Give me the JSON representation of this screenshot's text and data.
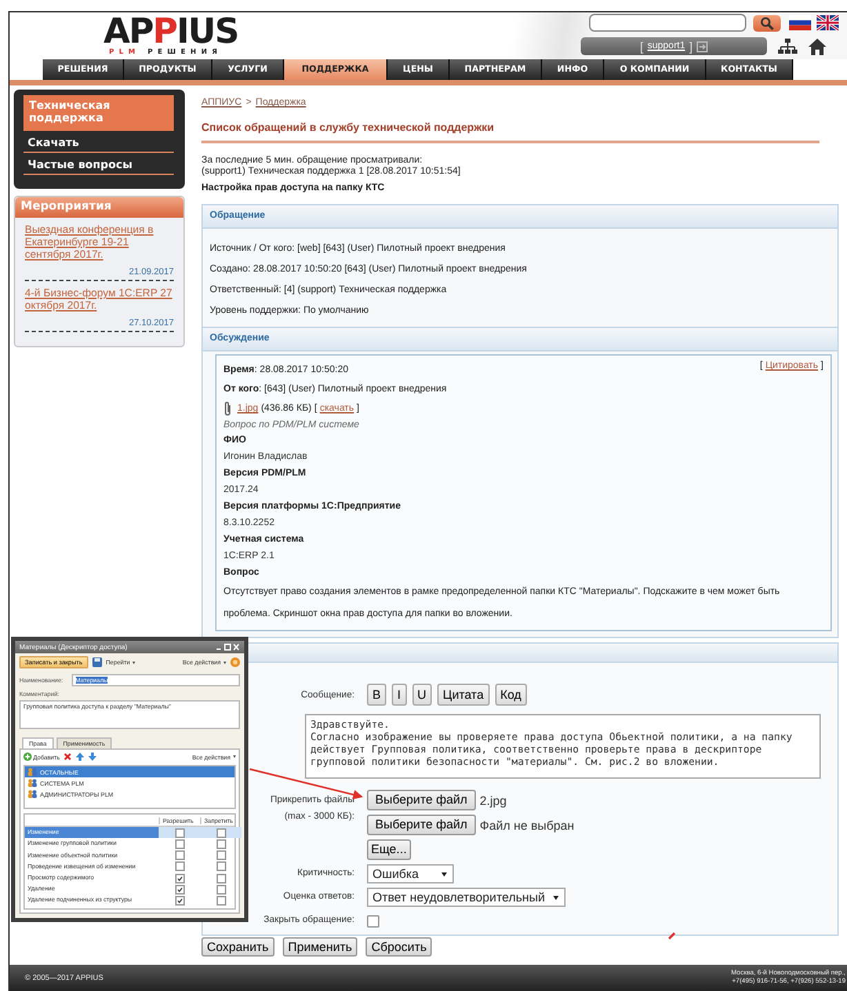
{
  "header": {
    "logo": {
      "parts": [
        {
          "text": "AP",
          "accent": false
        },
        {
          "text": "P",
          "accent": true
        },
        {
          "text": "IUS",
          "accent": false
        }
      ]
    },
    "tagline": {
      "parts": [
        {
          "text": "PLM",
          "accent": true
        },
        {
          "text": " РЕШЕНИЯ",
          "accent": false
        }
      ]
    },
    "user": {
      "open": "[",
      "name": "support1",
      "close": "]"
    }
  },
  "nav": [
    {
      "label": "РЕШЕНИЯ",
      "selected": false
    },
    {
      "label": "ПРОДУКТЫ",
      "selected": false
    },
    {
      "label": "УСЛУГИ",
      "selected": false
    },
    {
      "label": "ПОДДЕРЖКА",
      "selected": true
    },
    {
      "label": "ЦЕНЫ",
      "selected": false
    },
    {
      "label": "ПАРТНЕРАМ",
      "selected": false
    },
    {
      "label": "ИНФО",
      "selected": false
    },
    {
      "label": "О КОМПАНИИ",
      "selected": false
    },
    {
      "label": "КОНТАКТЫ",
      "selected": false
    }
  ],
  "sidebar": {
    "menu": [
      {
        "label": "Техническая поддержка",
        "selected": true
      },
      {
        "label": "Скачать",
        "selected": false
      },
      {
        "label": "Частые вопросы",
        "selected": false
      }
    ],
    "events": {
      "title": "Мероприятия",
      "items": [
        {
          "title": "Выездная конференция в Екатеринбурге 19-21 сентября 2017г.",
          "date": "21.09.2017"
        },
        {
          "title": "4-й Бизнес-форум 1С:ERP 27 октября 2017г.",
          "date": "27.10.2017"
        }
      ]
    }
  },
  "breadcrumb": {
    "separator": ">",
    "items": [
      "АППИУС",
      "Поддержка"
    ]
  },
  "page_title": "Список обращений в службу технической поддержки",
  "viewers": {
    "note": "За последние 5 мин. обращение просматривали:",
    "entries": [
      "(support1) Техническая поддержка 1 [28.08.2017 10:51:54]"
    ]
  },
  "subject": "Настройка прав доступа на папку КТС",
  "request": {
    "title": "Обращение",
    "lines": [
      "Источник / От кого: [web] [643] (User) Пилотный проект внедрения",
      "Создано: 28.08.2017 10:50:20 [643] (User) Пилотный проект внедрения",
      "Ответственный: [4] (support) Техническая поддержка",
      "Уровень поддержки: По умолчанию"
    ]
  },
  "discussion": {
    "title": "Обсуждение",
    "messages": [
      {
        "time": "**Время**: 28.08.2017 10:50:20",
        "quote": {
          "open": "[",
          "label": "Цитировать",
          "close": "]"
        },
        "from": "**От кого**: [643] (User) Пилотный проект внедрения",
        "attachment": {
          "file": "1.jpg",
          "size": "(436.86 КБ)",
          "open": "[",
          "download": "скачать",
          "close": "]"
        },
        "body": [
          {
            "kind": "note",
            "text": "Вопрос по PDM/PLM системе"
          },
          {
            "kind": "heading",
            "text": "ФИО"
          },
          {
            "kind": "value",
            "text": "Игонин Владислав"
          },
          {
            "kind": "heading",
            "text": "Версия PDM/PLM"
          },
          {
            "kind": "value",
            "text": "2017.24"
          },
          {
            "kind": "heading",
            "text": "Версия платформы 1С:Предприятие"
          },
          {
            "kind": "value",
            "text": "8.3.10.2252"
          },
          {
            "kind": "heading",
            "text": "Учетная система"
          },
          {
            "kind": "value",
            "text": "1С:ERP 2.1"
          },
          {
            "kind": "heading",
            "text": "Вопрос"
          },
          {
            "kind": "paragraph",
            "text": "Отсутствует право создания элементов в рамке предопределенной папки КТС \"Материалы\". Подскажите в чем может быть проблема. Скриншот окна прав доступа для папки во вложении."
          }
        ]
      }
    ]
  },
  "form": {
    "message_label": "Сообщение:",
    "format_buttons": [
      "B",
      "I",
      "U",
      "Цитата",
      "Код"
    ],
    "message": "Здравствуйте.\nСогласно изображение вы проверяете права доступа Обьектной политики, а на папку\nдействует Групповая политика, соответственно проверьте права в дескрипторе\nгрупповой политики безопасности \"материалы\". См. рис.2 во вложении.",
    "attach_label": "Прикрепить файлы",
    "attach_limit": "(max - 3000 КБ):",
    "files": [
      {
        "button": "Выберите файл",
        "name": "2.jpg"
      },
      {
        "button": "Выберите файл",
        "name": "Файл не выбран"
      }
    ],
    "more": "Еще...",
    "criticality": {
      "label": "Критичность:",
      "value": "Ошибка"
    },
    "rating": {
      "label": "Оценка ответов:",
      "value": "Ответ неудовлетворительный"
    },
    "close": {
      "label": "Закрыть обращение:",
      "checked": false
    },
    "actions": [
      "Сохранить",
      "Применить",
      "Сбросить"
    ]
  },
  "inset_window": {
    "title": "Материалы (Дескриптор доступа)",
    "save": "Записать и закрыть",
    "goto": "Перейти",
    "all_actions": "Все действия",
    "name_label": "Наименование:",
    "name_value": "Материалы",
    "comment_label": "Комментарий:",
    "comment": "Групповая политика доступа к разделу \"Материалы\"",
    "tabs": [
      {
        "label": "Права",
        "selected": true
      },
      {
        "label": "Применимость",
        "selected": false
      }
    ],
    "add": "Добавить",
    "list_actions": "Все действия",
    "groups": [
      {
        "label": "ОСТАЛЬНЫЕ",
        "selected": true
      },
      {
        "label": "СИСТЕМА PLM",
        "selected": false
      },
      {
        "label": "АДМИНИСТРАТОРЫ PLM",
        "selected": false
      }
    ],
    "columns": [
      "Разрешить",
      "Запретить"
    ],
    "rights": [
      {
        "label": "Изменение",
        "selected": true,
        "allow": false,
        "deny": false
      },
      {
        "label": "Изменение групповой политики",
        "selected": false,
        "allow": false,
        "deny": false
      },
      {
        "label": "Изменение объектной политики",
        "selected": false,
        "allow": false,
        "deny": false
      },
      {
        "label": "Проведение извещения об изменении",
        "selected": false,
        "allow": false,
        "deny": false
      },
      {
        "label": "Просмотр содержимого",
        "selected": false,
        "allow": true,
        "deny": false
      },
      {
        "label": "Удаление",
        "selected": false,
        "allow": true,
        "deny": false
      },
      {
        "label": "Удаление подчиненных из структуры",
        "selected": false,
        "allow": true,
        "deny": false
      }
    ]
  },
  "footer": {
    "copyright": "© 2005—2017 APPIUS",
    "address": [
      "Москва, 6-й Новоподмосковный пер.,",
      "+7(495) 916-71-56, +7(926) 552-13-19"
    ]
  }
}
